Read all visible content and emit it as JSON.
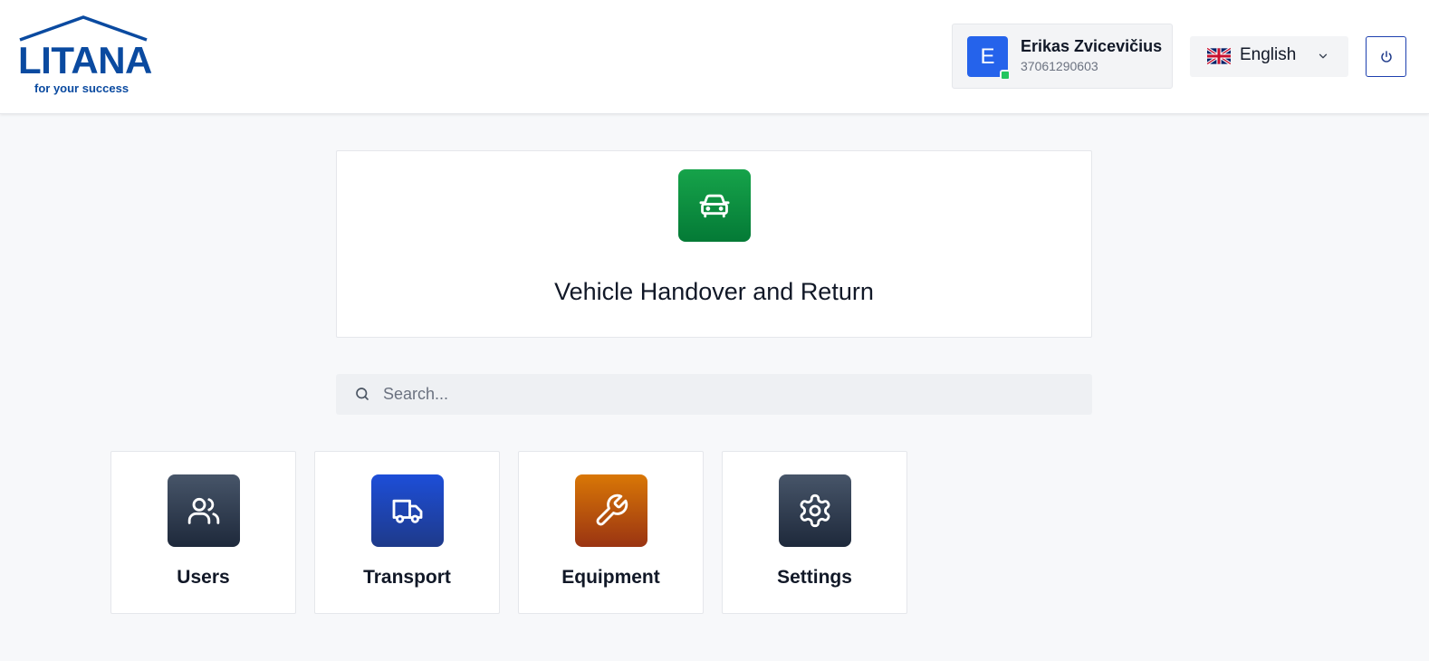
{
  "header": {
    "logo": {
      "word": "LITANA",
      "tagline": "for your success"
    },
    "user": {
      "initial": "E",
      "name": "Erikas Zvicevičius",
      "phone": "37061290603"
    },
    "language": {
      "selected": "English",
      "flag": "uk-flag-icon"
    },
    "power_icon": "power-icon"
  },
  "hero": {
    "title": "Vehicle Handover and Return",
    "icon": "car-icon"
  },
  "search": {
    "placeholder": "Search..."
  },
  "tiles": [
    {
      "label": "Users",
      "icon": "users-icon"
    },
    {
      "label": "Transport",
      "icon": "truck-icon"
    },
    {
      "label": "Equipment",
      "icon": "wrench-icon"
    },
    {
      "label": "Settings",
      "icon": "gear-icon"
    }
  ],
  "colors": {
    "brand": "#0a4aa0",
    "avatar": "#2563eb",
    "online": "#22c55e",
    "hero_icon": "#16a34a",
    "users_icon": "#334155",
    "transport_icon": "#1d4ed8",
    "equipment_icon": "#c2570c",
    "settings_icon": "#334155"
  }
}
